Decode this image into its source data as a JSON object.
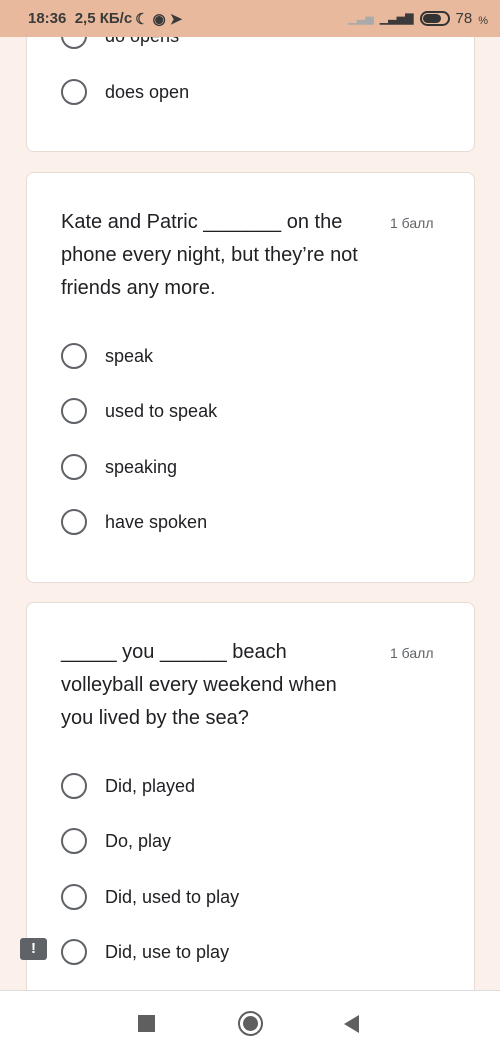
{
  "status_bar": {
    "time": "18:36",
    "speed": "2,5 КБ/с",
    "battery": "78",
    "battery_unit": "%",
    "battery_level": 78
  },
  "questions": [
    {
      "text": "",
      "points": "",
      "options": [
        "do opens",
        "does open"
      ]
    },
    {
      "text": "Kate and Patric _______ on the phone every night, but they’re not friends any more.",
      "points": "1 балл",
      "options": [
        "speak",
        "used to speak",
        "speaking",
        "have spoken"
      ]
    },
    {
      "text": "_____ you ______ beach volleyball every weekend when you lived by the sea?",
      "points": "1 балл",
      "options": [
        "Did, played",
        "Do, play",
        "Did, used to play",
        "Did, use to play"
      ]
    }
  ],
  "feedback_icon": "report-icon",
  "nav": {
    "icons": [
      "recents-square-icon",
      "home-circle-icon",
      "back-triangle-icon"
    ]
  }
}
